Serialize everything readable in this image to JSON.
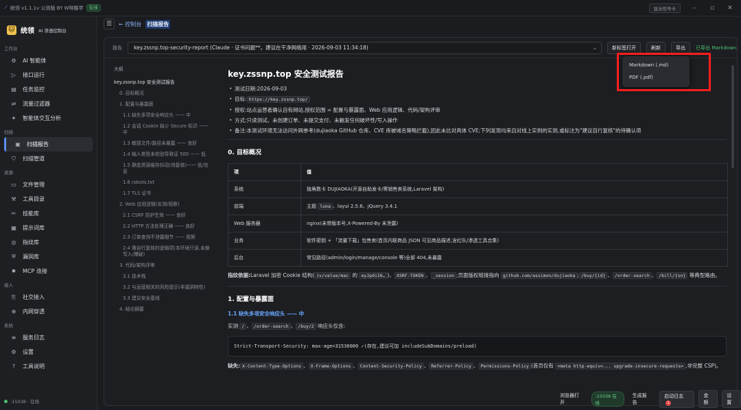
{
  "app": {
    "title": "统领 v1.1.1v 公测版 BY W咪酷学",
    "status_badge": "在线",
    "compact_btn": "显示信号卡"
  },
  "brand": {
    "name": "统领",
    "sub": "AI 渗透控制台"
  },
  "sidebar": {
    "sec_workbench": "工作台",
    "workbench": [
      {
        "label": "AI 智能体",
        "icon": "robot-icon"
      },
      {
        "label": "接口运行",
        "icon": "play-icon"
      },
      {
        "label": "任务监控",
        "icon": "task-icon"
      },
      {
        "label": "流量过滤器",
        "icon": "filter-icon"
      },
      {
        "label": "智能体交互分析",
        "icon": "analysis-icon"
      }
    ],
    "sec_scan": "扫描",
    "scan": [
      {
        "label": "扫描报告",
        "icon": "report-icon"
      },
      {
        "label": "扫描管道",
        "icon": "pipe-icon"
      }
    ],
    "sec_resources": "资源",
    "resources": [
      {
        "label": "文件管理",
        "icon": "folder-icon"
      },
      {
        "label": "工具目录",
        "icon": "wrench-icon"
      },
      {
        "label": "技能库",
        "icon": "tools-icon"
      },
      {
        "label": "提示词库",
        "icon": "prompt-icon"
      },
      {
        "label": "指纹库",
        "icon": "bulb-icon"
      },
      {
        "label": "漏洞库",
        "icon": "shield-icon"
      },
      {
        "label": "MCP 连接",
        "icon": "mcp-icon"
      }
    ],
    "sec_access": "接入",
    "access": [
      {
        "label": "社交接入",
        "icon": "social-icon"
      },
      {
        "label": "内网穿透",
        "icon": "tunnel-icon"
      }
    ],
    "sec_system": "系统",
    "system": [
      {
        "label": "服务日志",
        "icon": "log-icon"
      },
      {
        "label": "设置",
        "icon": "gear-icon"
      },
      {
        "label": "工具说明",
        "icon": "help-icon"
      }
    ],
    "footer": ":15038 · 在线"
  },
  "breadcrumb": {
    "back": "← 控制台",
    "current": "扫描报告"
  },
  "toolbar": {
    "label": "报告",
    "select_value": "key.zssnp.top-security-report (Claude · 证书问题**。建议在干净网络用 · 2026-09-03 11:34:18)",
    "open_new": "新标签打开",
    "refresh": "刷新",
    "export": "导出",
    "exported": "已导出 Markdown"
  },
  "export_menu": [
    "Markdown (.md)",
    "PDF (.pdf)"
  ],
  "outline": {
    "heading": "大纲",
    "title": "key.zssnp.top 安全测试报告",
    "items": [
      {
        "t": "0. 目标概况",
        "l": 1
      },
      {
        "t": "1. 配置与暴露面",
        "l": 1
      },
      {
        "t": "1.1 缺失多项安全响应头 —— 中",
        "l": 2
      },
      {
        "t": "1.2 会话 Cookie 缺少 Secure 标识 —— 中",
        "l": 2
      },
      {
        "t": "1.3 敏感文件/路径未暴露 —— 良好",
        "l": 2
      },
      {
        "t": "1.4 输入类型未校验导致证 500 —— 低",
        "l": 2
      },
      {
        "t": "1.5 静态资源缓存抖动(待复核)—— 低/信息",
        "l": 2
      },
      {
        "t": "1.6 robots.txt",
        "l": 2
      },
      {
        "t": "1.7 TLS 证书",
        "l": 2
      },
      {
        "t": "2. Web 应用逻辑(实测/观察)",
        "l": 1
      },
      {
        "t": "2.1 CSRF 防护生效 —— 良好",
        "l": 2
      },
      {
        "t": "2.2 HTTP 方法处理正确 —— 良好",
        "l": 2
      },
      {
        "t": "2.3 订单查询不泄露细节 —— 观察",
        "l": 2
      },
      {
        "t": "2.4 需自行复核的逻辑项(本环境只读,未做写入/爆破)",
        "l": 2
      },
      {
        "t": "3. 代码/架构评审",
        "l": 1
      },
      {
        "t": "3.1 技术栈",
        "l": 2
      },
      {
        "t": "3.2 与运营相关的风险提示(非漏洞特性)",
        "l": 2
      },
      {
        "t": "3.3 建议安全基线",
        "l": 2
      },
      {
        "t": "4. 结论摘要",
        "l": 1
      }
    ]
  },
  "doc": {
    "h1": "key.zssnp.top 安全测试报告",
    "meta": {
      "date": "测试日期:2026-09-03",
      "target_label": "目标:",
      "target_url": "https://key.zssnp.top/",
      "scope": "授权:站点运营者确认自有网站,授权范围 = 配置与暴露面、Web 应用逻辑、代码/架构评审",
      "method": "方式:只读测试。未创建订单、未提交支付、未触发任何破坏性/写入操作",
      "note": "备注:本测试环境无法访问外网参考(dujiaoka GitHub 仓库、CVE 库被域名策略拦截),因此未比对具体 CVE;下列发现均来自对线上实例的实测,或标注为\"建议自行复核\"的待确认项"
    },
    "sec0": "0. 目标概况",
    "table": {
      "headers": [
        "项",
        "值"
      ],
      "rows": [
        {
          "k": "系统",
          "v": "独角数卡 DUJIAOKA(开源自助发卡/寄销售卖系统,Laravel 架构)"
        },
        {
          "k": "前端",
          "v_pre": "主题 ",
          "v_code": "luna",
          "v_post": "、layui 2.5.6、jQuery 3.4.1"
        },
        {
          "k": "Web 服务器",
          "v": "nginx(未带版本号,X-Powered-By 未泄露)"
        },
        {
          "k": "业务",
          "v": "软件密钥 + 「流量下载」包售卖(首页内联商品 JSON 可见商品描述,含红队/渗透工具合集)"
        },
        {
          "k": "后台",
          "v": "常见路径(admin/login/manage/console 等)全部 404,未暴露"
        }
      ]
    },
    "basis": {
      "t1": "指纹依据:",
      "t2": "Laravel 加密 Cookie 结构(",
      "c1": "iv/value/mac",
      "t3": " 的 ",
      "c2": "eyJpdiI6…",
      "t4": ")、",
      "c3": "XSRF-TOKEN",
      "t5": "、",
      "c4": "_session",
      "t6": ";页面版权链接指向 ",
      "c5": "github.com/assimon/dujiaoka",
      "t7": ";",
      "c6": "/buy/{id}",
      "t8": "、",
      "c7": "/order-search",
      "t9": "、",
      "c8": "/bill/{sn}",
      "t10": " 等典型路由。"
    },
    "sec1": "1. 配置与暴露面",
    "sec11": "1.1 缺失多项安全响应头 —— 中",
    "p11": {
      "t1": "实测 ",
      "c1": "/",
      "t2": "、",
      "c2": "/order-search",
      "t3": "、",
      "c3": "/buy/2",
      "t4": " 响应头仅含:"
    },
    "pre": "Strict-Transport-Security: max-age=31536000   ✓(存在,建议可加 includeSubDomains/preload)",
    "missing": {
      "t1": "缺失:",
      "c1": "X-Content-Type-Options",
      "t2": "、",
      "c2": "X-Frame-Options",
      "t3": "、",
      "c3": "Content-Security-Policy",
      "t4": "、",
      "c4": "Referrer-Policy",
      "t5": "、",
      "c5": "Permissions-Policy",
      "t6": "(首页仅有 ",
      "c6": "<meta http-equiv=... upgrade-insecure-requests>",
      "t7": ",非完整 CSP)。"
    }
  },
  "statusbar": {
    "browser": "浏览器打开",
    "port": ":15038 在线",
    "gen": "生成报告",
    "log": "启动日志",
    "log_count": "1",
    "save": "金额",
    "settings": "设置"
  }
}
